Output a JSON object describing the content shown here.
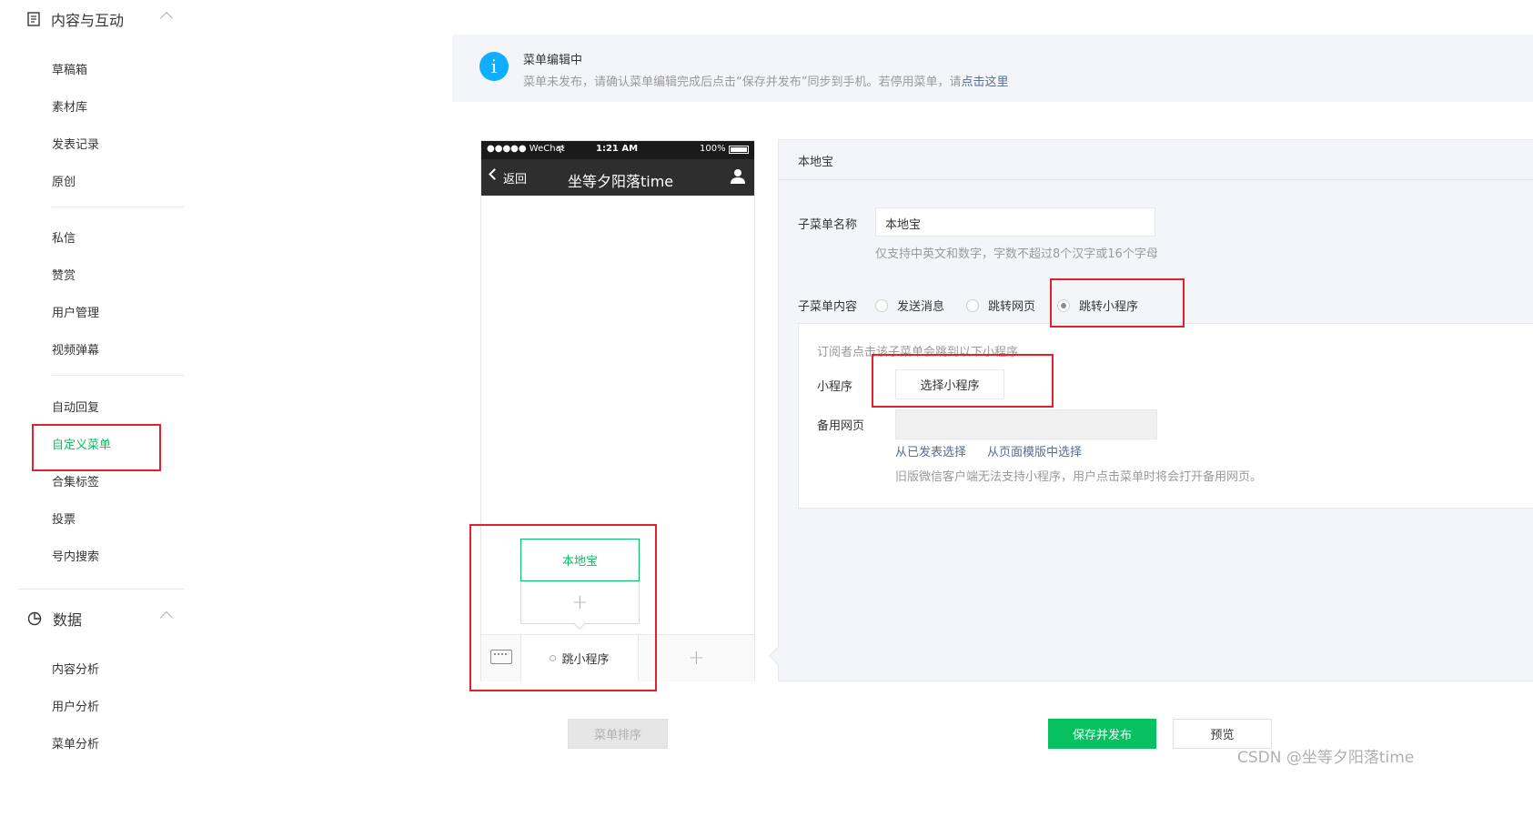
{
  "sidebar": {
    "section1": {
      "title": "内容与互动"
    },
    "group1": [
      "草稿箱",
      "素材库",
      "发表记录",
      "原创"
    ],
    "group2": [
      "私信",
      "赞赏",
      "用户管理",
      "视频弹幕"
    ],
    "group3": [
      "自动回复",
      "自定义菜单",
      "合集标签",
      "投票",
      "号内搜索"
    ],
    "section2": {
      "title": "数据"
    },
    "group4": [
      "内容分析",
      "用户分析",
      "菜单分析"
    ]
  },
  "notice": {
    "title": "菜单编辑中",
    "desc": "菜单未发布，请确认菜单编辑完成后点击“保存并发布”同步到手机。若停用菜单，请",
    "link": "点击这里"
  },
  "phone": {
    "status_carrier": "●●●●● WeChat",
    "status_time": "1:21 AM",
    "status_battery": "100%",
    "back_label": "返回",
    "title": "坐等夕阳落time",
    "submenu_item": "本地宝",
    "main_menu_label": "跳小程序"
  },
  "editor": {
    "header": "本地宝",
    "name_label": "子菜单名称",
    "name_value": "本地宝",
    "name_hint": "仅支持中英文和数字，字数不超过8个汉字或16个字母",
    "content_label": "子菜单内容",
    "options": [
      "发送消息",
      "跳转网页",
      "跳转小程序"
    ],
    "selected_option": "跳转小程序",
    "box_hint": "订阅者点击该子菜单会跳到以下小程序",
    "miniprogram_label": "小程序",
    "select_button": "选择小程序",
    "fallback_label": "备用网页",
    "link1": "从已发表选择",
    "link2": "从页面模版中选择",
    "fallback_hint": "旧版微信客户端无法支持小程序，用户点击菜单时将会打开备用网页。"
  },
  "buttons": {
    "sort": "菜单排序",
    "publish": "保存并发布",
    "preview": "预览"
  },
  "watermark": "CSDN @坐等夕阳落time",
  "colors": {
    "accent": "#07c160",
    "info": "#10aeff",
    "annotation": "#e5202e",
    "link": "#576b95"
  }
}
